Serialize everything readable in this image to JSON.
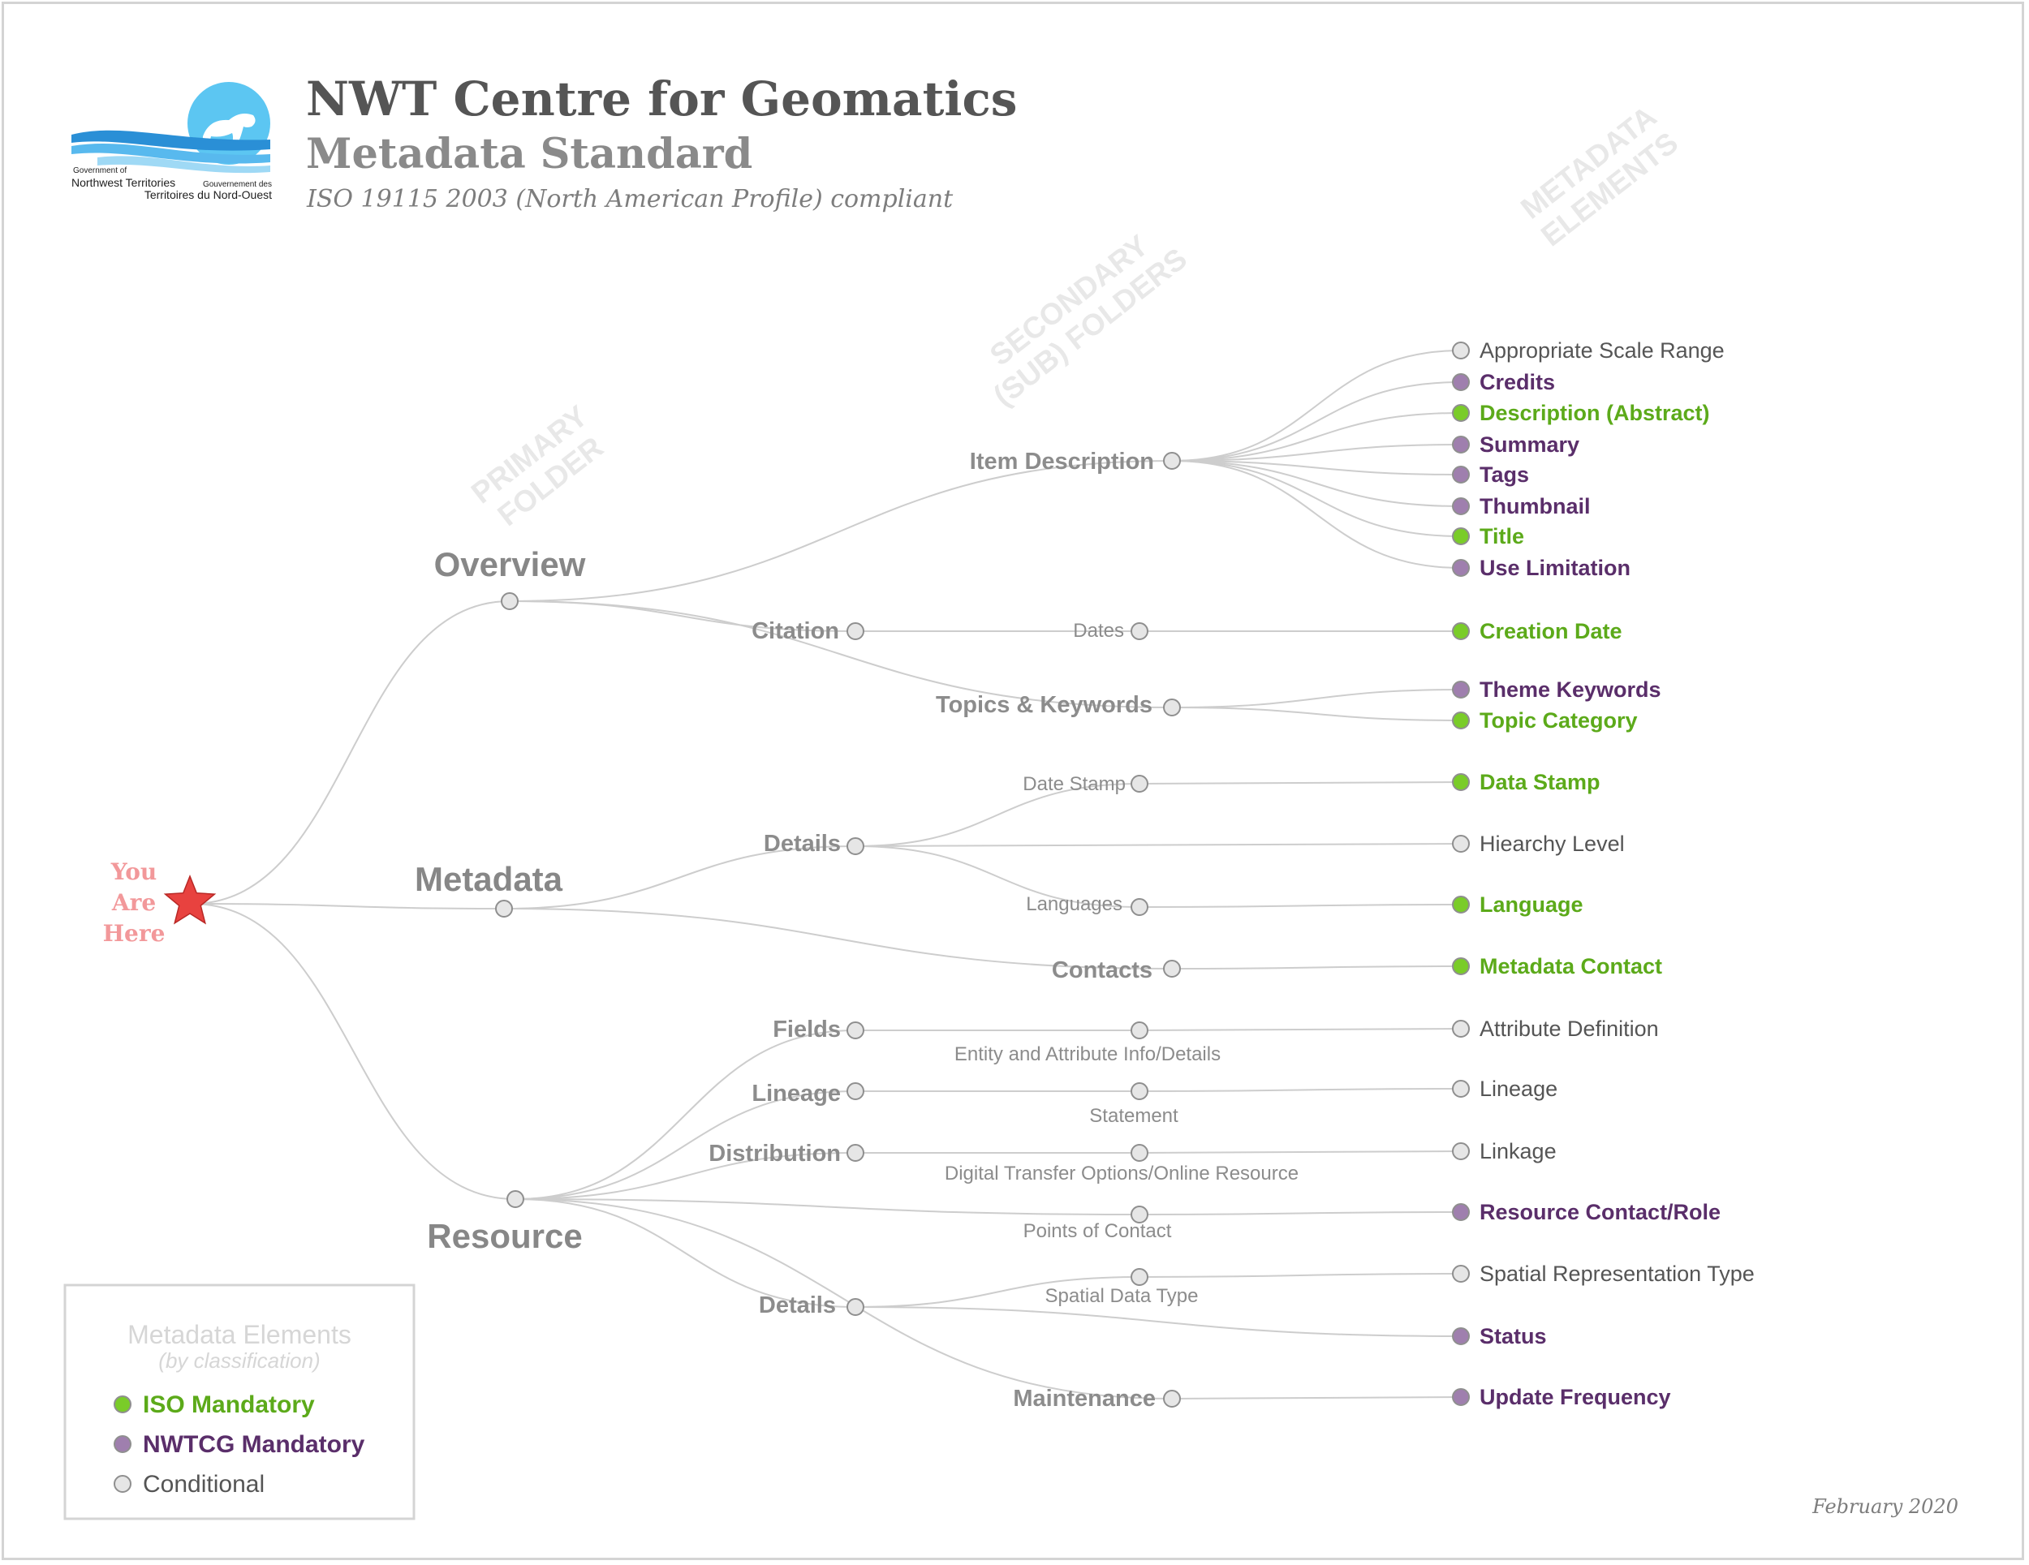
{
  "header": {
    "title": "NWT Centre for Geomatics",
    "subtitle": "Metadata Standard",
    "compliance": "ISO 19115 2003 (North American Profile) compliant"
  },
  "logo": {
    "icon": "polar-bear-logo-icon",
    "line1": "Government of",
    "line2": "Northwest Territories",
    "line3": "Gouvernement des",
    "line4": "Territoires du Nord-Ouest"
  },
  "columns": {
    "primary": [
      "PRIMARY",
      "FOLDER"
    ],
    "secondary": [
      "SECONDARY",
      "(SUB) FOLDERS"
    ],
    "elements": [
      "METADATA",
      "ELEMENTS"
    ]
  },
  "root": {
    "lines": [
      "You",
      "Are",
      "Here"
    ],
    "icon": "star-icon"
  },
  "colors": {
    "iso": "#5caa1a",
    "iso_dot": "#7acc29",
    "nwtcg": "#5a2e6a",
    "nwtcg_dot": "#9f7fae",
    "conditional": "#555555",
    "conditional_dot": "#e6e6e6",
    "star": "#e8423f"
  },
  "primary": {
    "overview": "Overview",
    "metadata": "Metadata",
    "resource": "Resource"
  },
  "secondary": {
    "item_description": "Item Description",
    "citation": "Citation",
    "topics_keywords": "Topics & Keywords",
    "meta_details": "Details",
    "contacts": "Contacts",
    "fields": "Fields",
    "lineage": "Lineage",
    "distribution": "Distribution",
    "res_details": "Details",
    "maintenance": "Maintenance"
  },
  "tertiary": {
    "dates": "Dates",
    "date_stamp": "Date Stamp",
    "languages": "Languages",
    "entity_attribute": "Entity and Attribute Info/Details",
    "statement": "Statement",
    "digital_transfer": "Digital Transfer Options/Online Resource",
    "points_of_contact": "Points of Contact",
    "spatial_data_type": "Spatial Data Type"
  },
  "elements": [
    {
      "label": "Appropriate Scale Range",
      "class": "conditional"
    },
    {
      "label": "Credits",
      "class": "nwtcg"
    },
    {
      "label": "Description (Abstract)",
      "class": "iso"
    },
    {
      "label": "Summary",
      "class": "nwtcg"
    },
    {
      "label": "Tags",
      "class": "nwtcg"
    },
    {
      "label": "Thumbnail",
      "class": "nwtcg"
    },
    {
      "label": "Title",
      "class": "iso"
    },
    {
      "label": "Use Limitation",
      "class": "nwtcg"
    },
    {
      "label": "Creation Date",
      "class": "iso"
    },
    {
      "label": "Theme Keywords",
      "class": "nwtcg"
    },
    {
      "label": "Topic Category",
      "class": "iso"
    },
    {
      "label": "Data Stamp",
      "class": "iso"
    },
    {
      "label": "Hiearchy Level",
      "class": "conditional"
    },
    {
      "label": "Language",
      "class": "iso"
    },
    {
      "label": "Metadata Contact",
      "class": "iso"
    },
    {
      "label": "Attribute Definition",
      "class": "conditional"
    },
    {
      "label": "Lineage",
      "class": "conditional"
    },
    {
      "label": "Linkage",
      "class": "conditional"
    },
    {
      "label": "Resource Contact/Role",
      "class": "nwtcg"
    },
    {
      "label": "Spatial Representation Type",
      "class": "conditional"
    },
    {
      "label": "Status",
      "class": "nwtcg"
    },
    {
      "label": "Update Frequency",
      "class": "nwtcg"
    }
  ],
  "legend": {
    "title": "Metadata Elements",
    "subtitle": "(by classification)",
    "items": [
      {
        "label": "ISO Mandatory",
        "class": "iso"
      },
      {
        "label": "NWTCG Mandatory",
        "class": "nwtcg"
      },
      {
        "label": "Conditional",
        "class": "conditional"
      }
    ]
  },
  "footer": {
    "date": "February 2020"
  }
}
